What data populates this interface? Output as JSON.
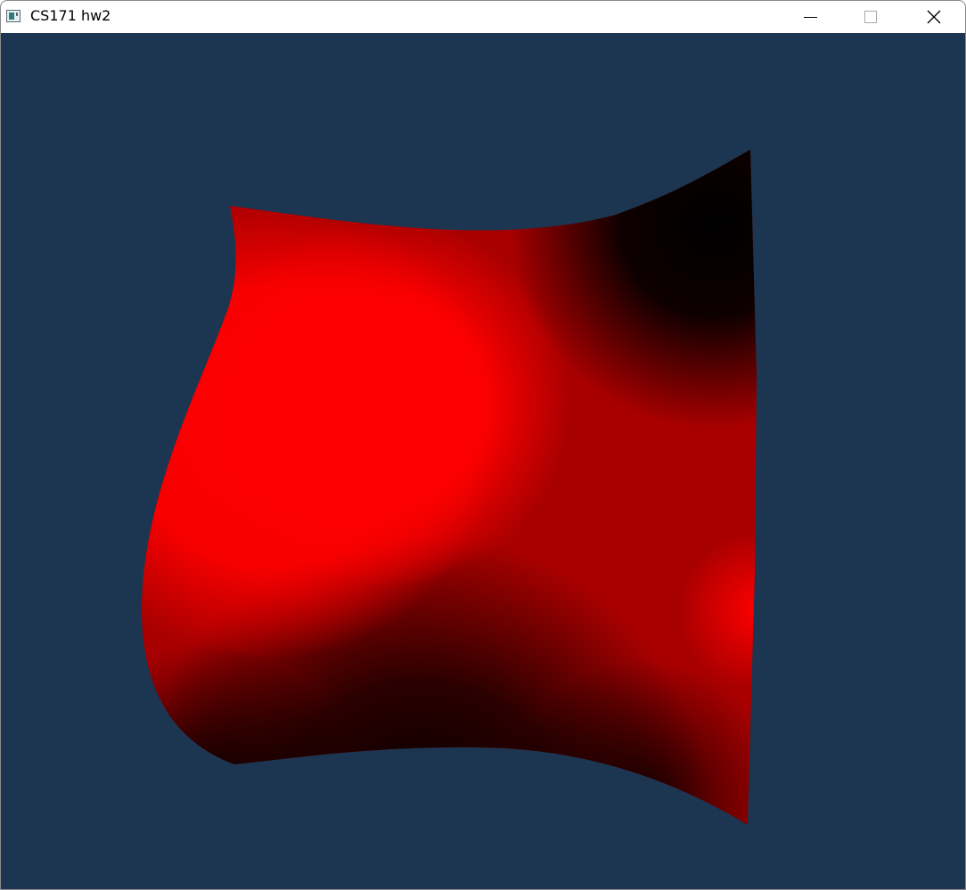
{
  "window": {
    "title": "CS171 hw2",
    "app_icon": "app-window-icon",
    "controls": {
      "minimize_icon": "minimize-icon",
      "maximize_icon": "maximize-icon",
      "close_icon": "close-icon"
    }
  },
  "viewport": {
    "background_color": "#1c3550",
    "surface_color": "#ff0000",
    "shadow_color": "#000000"
  }
}
